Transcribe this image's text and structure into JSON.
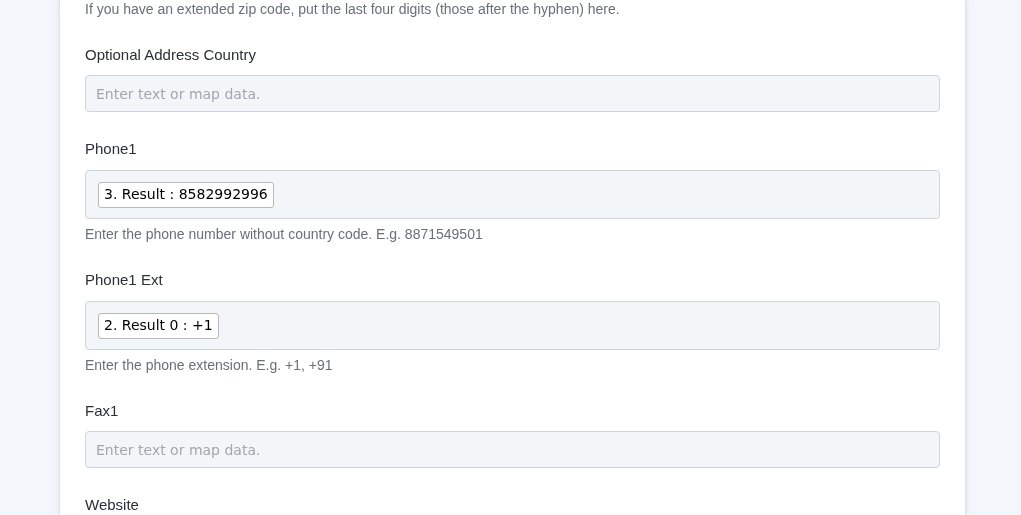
{
  "top_hint": "If you have an extended zip code, put the last four digits (those after the hyphen) here.",
  "fields": [
    {
      "label": "Optional Address Country",
      "kind": "text",
      "placeholder": "Enter text or map data."
    },
    {
      "label": "Phone1",
      "kind": "mapped",
      "tokens": [
        "3. Result : 8582992996"
      ],
      "help": "Enter the phone number without country code. E.g. 8871549501"
    },
    {
      "label": "Phone1 Ext",
      "kind": "mapped",
      "tokens": [
        "2. Result 0 : +1"
      ],
      "help": "Enter the phone extension. E.g. +1, +91"
    },
    {
      "label": "Fax1",
      "kind": "text",
      "placeholder": "Enter text or map data."
    },
    {
      "label": "Website",
      "kind": "label_only"
    }
  ]
}
